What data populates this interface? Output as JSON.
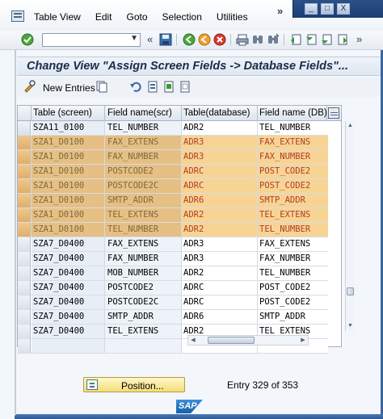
{
  "menubar": {
    "items": [
      "Table View",
      "Edit",
      "Goto",
      "Selection",
      "Utilities"
    ],
    "more_label": "»"
  },
  "window_controls": [
    "_",
    "□",
    "X"
  ],
  "toolbar": {
    "command_value": "",
    "collapse_label": "«",
    "more_label": "»"
  },
  "view": {
    "title": "Change View \"Assign Screen Fields -> Database Fields\"..."
  },
  "app_toolbar": {
    "new_entries_label": "New Entries"
  },
  "table": {
    "columns": [
      "Table (screen)",
      "Field name(scr)",
      "Table(database)",
      "Field name (DB)"
    ],
    "rows": [
      {
        "table_screen": "SZA11_0100",
        "field_scr": "TEL_NUMBER",
        "table_db": "ADR2",
        "field_db": "TEL_NUMBER",
        "highlighted": false
      },
      {
        "table_screen": "SZA1_D0100",
        "field_scr": "FAX_EXTENS",
        "table_db": "ADR3",
        "field_db": "FAX_EXTENS",
        "highlighted": true
      },
      {
        "table_screen": "SZA1_D0100",
        "field_scr": "FAX_NUMBER",
        "table_db": "ADR3",
        "field_db": "FAX_NUMBER",
        "highlighted": true
      },
      {
        "table_screen": "SZA1_D0100",
        "field_scr": "POSTCODE2",
        "table_db": "ADRC",
        "field_db": "POST_CODE2",
        "highlighted": true
      },
      {
        "table_screen": "SZA1_D0100",
        "field_scr": "POSTCODE2C",
        "table_db": "ADRC",
        "field_db": "POST_CODE2",
        "highlighted": true
      },
      {
        "table_screen": "SZA1_D0100",
        "field_scr": "SMTP_ADDR",
        "table_db": "ADR6",
        "field_db": "SMTP_ADDR",
        "highlighted": true
      },
      {
        "table_screen": "SZA1_D0100",
        "field_scr": "TEL_EXTENS",
        "table_db": "ADR2",
        "field_db": "TEL_EXTENS",
        "highlighted": true
      },
      {
        "table_screen": "SZA1_D0100",
        "field_scr": "TEL_NUMBER",
        "table_db": "ADR2",
        "field_db": "TEL_NUMBER",
        "highlighted": true
      },
      {
        "table_screen": "SZA7_D0400",
        "field_scr": "FAX_EXTENS",
        "table_db": "ADR3",
        "field_db": "FAX_EXTENS",
        "highlighted": false
      },
      {
        "table_screen": "SZA7_D0400",
        "field_scr": "FAX_NUMBER",
        "table_db": "ADR3",
        "field_db": "FAX_NUMBER",
        "highlighted": false
      },
      {
        "table_screen": "SZA7_D0400",
        "field_scr": "MOB_NUMBER",
        "table_db": "ADR2",
        "field_db": "TEL_NUMBER",
        "highlighted": false
      },
      {
        "table_screen": "SZA7_D0400",
        "field_scr": "POSTCODE2",
        "table_db": "ADRC",
        "field_db": "POST_CODE2",
        "highlighted": false
      },
      {
        "table_screen": "SZA7_D0400",
        "field_scr": "POSTCODE2C",
        "table_db": "ADRC",
        "field_db": "POST_CODE2",
        "highlighted": false
      },
      {
        "table_screen": "SZA7_D0400",
        "field_scr": "SMTP_ADDR",
        "table_db": "ADR6",
        "field_db": "SMTP_ADDR",
        "highlighted": false
      },
      {
        "table_screen": "SZA7_D0400",
        "field_scr": "TEL_EXTENS",
        "table_db": "ADR2",
        "field_db": "TEL_EXTENS",
        "highlighted": false
      },
      {
        "table_screen": "",
        "field_scr": "",
        "table_db": "",
        "field_db": "",
        "highlighted": false
      }
    ]
  },
  "footer": {
    "position_button_label": "Position...",
    "entry_text": "Entry 329 of 353",
    "logo_text": "SAP"
  },
  "colors": {
    "highlight_row": "#f7d494",
    "highlight_text_db": "#b13c2a",
    "title_text": "#1a2d48",
    "window_frame": "#2c5188"
  }
}
